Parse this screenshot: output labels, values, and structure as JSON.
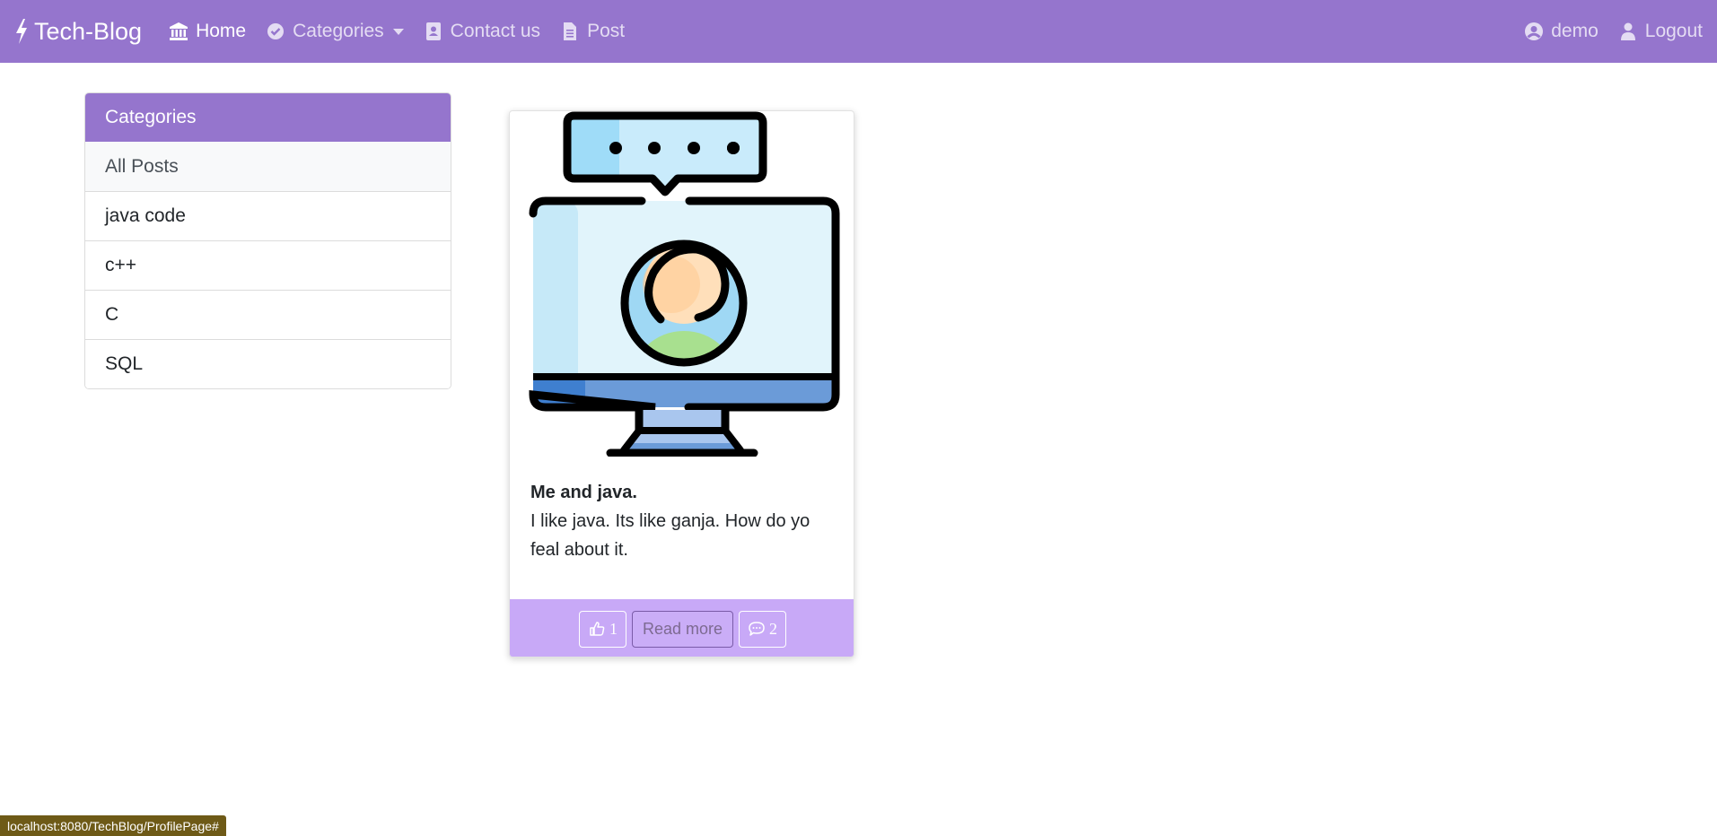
{
  "navbar": {
    "brand": "Tech-Blog",
    "links": [
      {
        "label": "Home",
        "icon": "bank-icon"
      },
      {
        "label": "Categories",
        "icon": "check-circle-icon"
      },
      {
        "label": "Contact us",
        "icon": "address-book-icon"
      },
      {
        "label": "Post",
        "icon": "file-text-icon"
      }
    ],
    "right_links": [
      {
        "label": "demo",
        "icon": "user-circle-icon"
      },
      {
        "label": "Logout",
        "icon": "user-icon"
      }
    ]
  },
  "categories": {
    "header": "Categories",
    "items": [
      "All Posts",
      "java code",
      "c++",
      "C",
      "SQL"
    ]
  },
  "post": {
    "title": "Me and java.",
    "content": "I like java. Its like ganja. How do yo feal about it.",
    "likes": "1",
    "read_more": "Read more",
    "comments": "2",
    "image_icon": "computer-user-chat-illustration"
  },
  "status_bar": {
    "url": "localhost:8080/TechBlog/ProfilePage#"
  },
  "colors": {
    "primary": "#9575cd",
    "card_footer": "#c8a9f7",
    "status_bar": "#6e5a17"
  }
}
